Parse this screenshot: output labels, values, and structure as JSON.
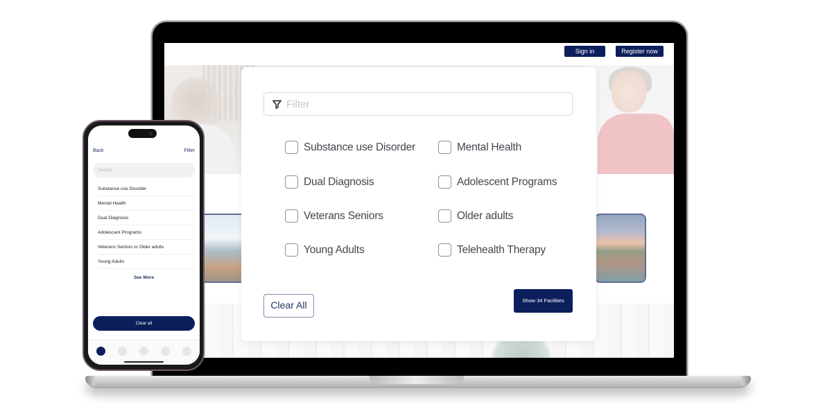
{
  "website": {
    "header": {
      "sign_in_label": "Sign in",
      "register_label": "Register now"
    },
    "filter_modal": {
      "search_placeholder": "Filter",
      "search_value": "",
      "options": [
        {
          "label": "Substance use Disorder",
          "checked": false
        },
        {
          "label": "Mental Health",
          "checked": false
        },
        {
          "label": "Dual Diagnosis",
          "checked": false
        },
        {
          "label": "Adolescent Programs",
          "checked": false
        },
        {
          "label": "Veterans Seniors",
          "checked": false
        },
        {
          "label": "Older adults",
          "checked": false
        },
        {
          "label": "Young Adults",
          "checked": false
        },
        {
          "label": "Telehealth Therapy",
          "checked": false
        }
      ],
      "clear_all_label": "Clear All",
      "show_results_label": "Show 34 Facilities"
    }
  },
  "mobile": {
    "back_label": "Back",
    "title_label": "Filter",
    "search_placeholder": "Search",
    "items": [
      "Substance use Disorder",
      "Mental Health",
      "Dual Diagnosis",
      "Adolescent Programs",
      "Veterans Seniors or Older adults",
      "Young Adults"
    ],
    "see_more_label": "See More",
    "clear_all_label": "Clear all",
    "pagination": {
      "total": 5,
      "active_index": 0
    }
  },
  "colors": {
    "brand_navy": "#0c1f5c",
    "checkbox_border": "#8b8f99",
    "option_text": "#44464d"
  }
}
